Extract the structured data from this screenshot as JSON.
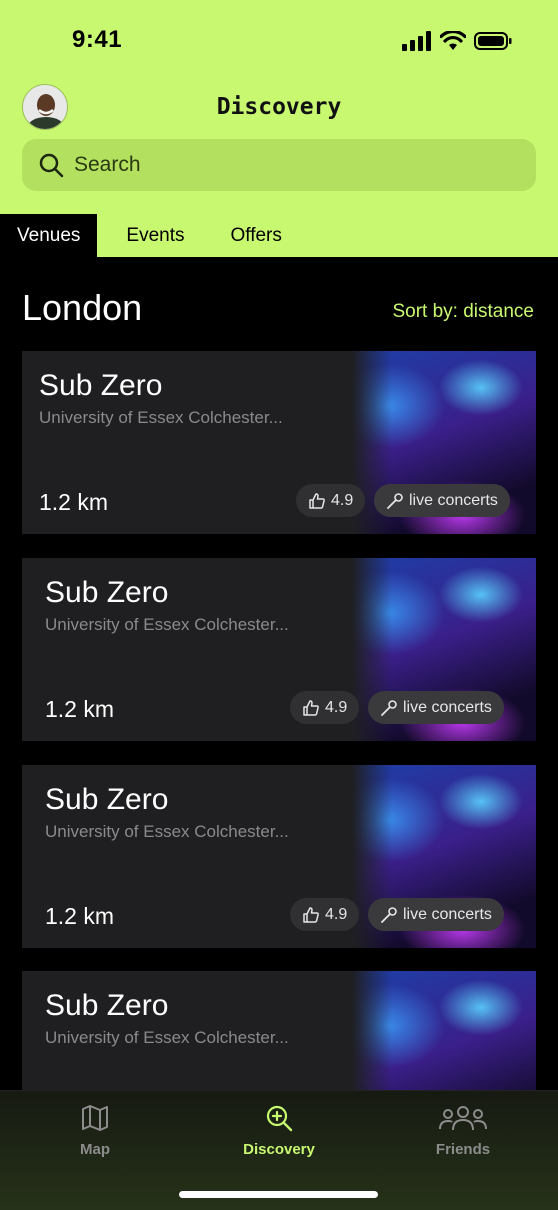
{
  "status": {
    "time": "9:41"
  },
  "header": {
    "title": "Discovery"
  },
  "search": {
    "placeholder": "Search"
  },
  "tabs": [
    {
      "label": "Venues",
      "active": true
    },
    {
      "label": "Events",
      "active": false
    },
    {
      "label": "Offers",
      "active": false
    }
  ],
  "section": {
    "title": "London",
    "sort_label": "Sort by: distance"
  },
  "venues": [
    {
      "name": "Sub Zero",
      "address": "University of Essex Colchester...",
      "distance": "1.2 km",
      "rating": "4.9",
      "tag": "live concerts"
    },
    {
      "name": "Sub Zero",
      "address": "University of Essex Colchester...",
      "distance": "1.2 km",
      "rating": "4.9",
      "tag": "live concerts"
    },
    {
      "name": "Sub Zero",
      "address": "University of Essex Colchester...",
      "distance": "1.2 km",
      "rating": "4.9",
      "tag": "live concerts"
    },
    {
      "name": "Sub Zero",
      "address": "University of Essex Colchester...",
      "distance": "",
      "rating": "",
      "tag": ""
    }
  ],
  "nav": {
    "items": [
      {
        "label": "Map",
        "icon": "map-icon"
      },
      {
        "label": "Discovery",
        "icon": "discovery-search-icon",
        "active": true
      },
      {
        "label": "Friends",
        "icon": "friends-icon"
      }
    ]
  },
  "colors": {
    "accent": "#c8f870",
    "card": "#1f1f21",
    "background": "#000000"
  }
}
